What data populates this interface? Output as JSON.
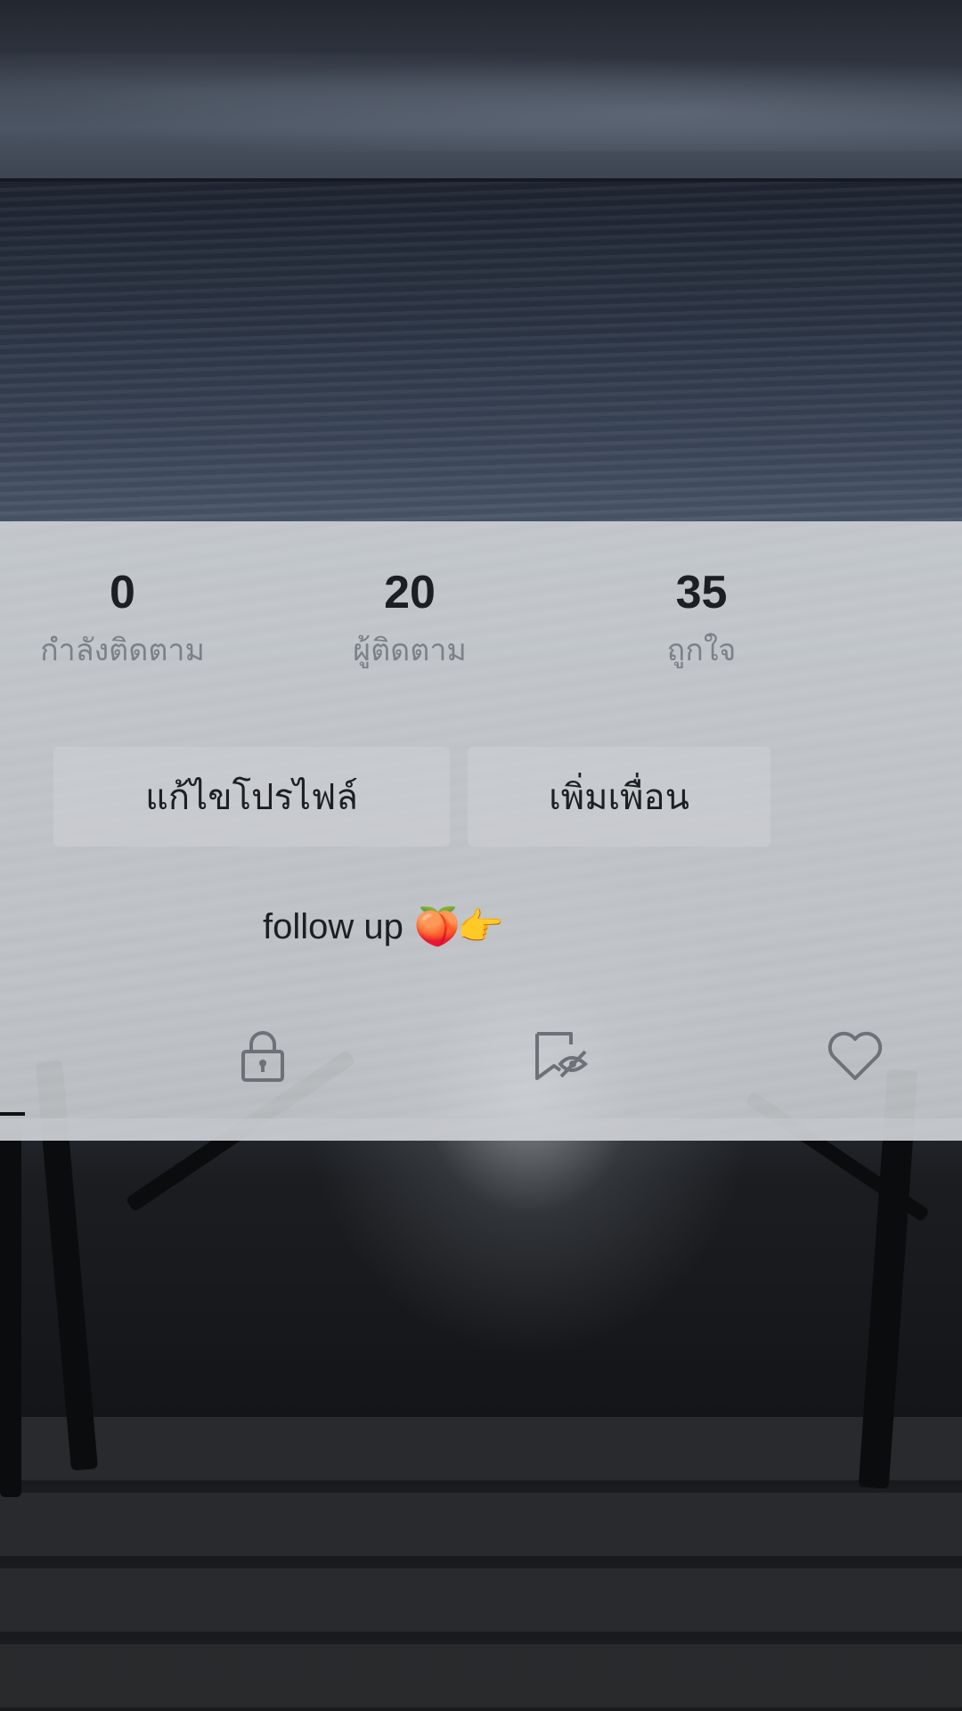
{
  "profile": {
    "stats": [
      {
        "value": "0",
        "label": "กำลังติดตาม"
      },
      {
        "value": "20",
        "label": "ผู้ติดตาม"
      },
      {
        "value": "35",
        "label": "ถูกใจ"
      }
    ],
    "buttons": {
      "edit_profile": "แก้ไขโปรไฟล์",
      "add_friends": "เพิ่มเพื่อน"
    },
    "bio": {
      "text": "follow up",
      "emoji": "🍑👉"
    },
    "tabs": [
      {
        "icon": "lock-icon"
      },
      {
        "icon": "bookmark-hidden-icon"
      },
      {
        "icon": "heart-icon"
      }
    ]
  },
  "colors": {
    "panel": "#d2d5d9",
    "text_primary": "#1d1f22",
    "text_secondary": "#7d8187",
    "icon": "#6e7278"
  }
}
